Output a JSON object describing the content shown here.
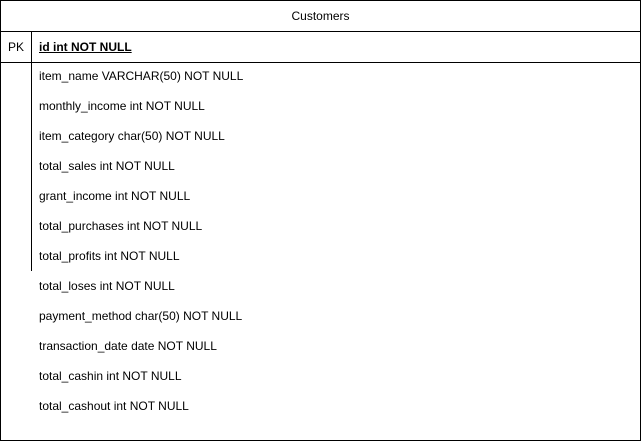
{
  "entity": {
    "title": "Customers",
    "primary_key": {
      "key_label": "PK",
      "field": "id int NOT NULL"
    },
    "attributes": [
      "item_name VARCHAR(50) NOT NULL",
      "monthly_income int NOT NULL",
      "item_category char(50) NOT NULL",
      "total_sales int NOT NULL",
      "grant_income int NOT NULL",
      "total_purchases int NOT NULL",
      "total_profits int NOT NULL",
      "total_loses int NOT NULL",
      "payment_method char(50) NOT NULL",
      "transaction_date date NOT NULL",
      "total_cashin int NOT NULL",
      "total_cashout int NOT NULL"
    ]
  }
}
